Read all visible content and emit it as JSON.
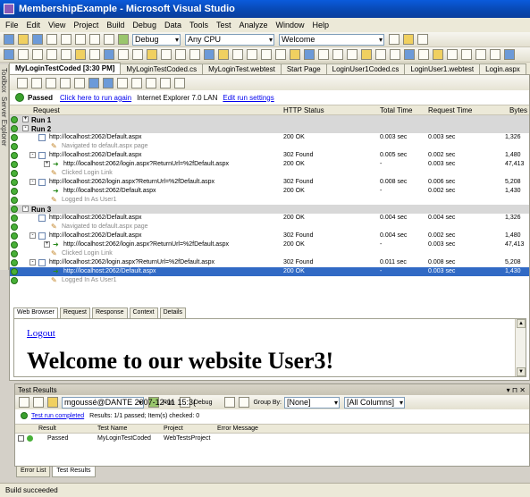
{
  "window": {
    "title": "MembershipExample - Microsoft Visual Studio"
  },
  "menu": [
    "File",
    "Edit",
    "View",
    "Project",
    "Build",
    "Debug",
    "Data",
    "Tools",
    "Test",
    "Analyze",
    "Window",
    "Help"
  ],
  "toolbar": {
    "config": "Debug",
    "platform": "Any CPU",
    "find": "Welcome"
  },
  "side_tabs": [
    "Toolbox",
    "Server Explorer"
  ],
  "doc_tabs": [
    "MyLoginTestCoded [3:30 PM]",
    "MyLoginTestCoded.cs",
    "MyLoginTest.webtest",
    "Start Page",
    "LoginUser1Coded.cs",
    "LoginUser1.webtest",
    "Login.aspx"
  ],
  "webtest": {
    "status": "Passed",
    "run_again": "Click here to run again",
    "browser_info": "Internet Explorer 7.0  LAN",
    "edit_settings": "Edit run settings",
    "columns": {
      "request": "Request",
      "http_status": "HTTP Status",
      "total_time": "Total Time",
      "request_time": "Request Time",
      "bytes": "Bytes"
    },
    "rows": [
      {
        "kind": "run",
        "label": "Run 1",
        "exp": "+",
        "status": "",
        "total": "",
        "req": "",
        "bytes": ""
      },
      {
        "kind": "run",
        "label": "Run 2",
        "exp": "-",
        "status": "",
        "total": "",
        "req": "",
        "bytes": ""
      },
      {
        "kind": "req",
        "label": "http://localhost:2062/Default.aspx",
        "status": "200 OK",
        "total": "0.003 sec",
        "req": "0.003 sec",
        "bytes": "1,326"
      },
      {
        "kind": "note",
        "label": "Navigated to default.aspx page",
        "status": "",
        "total": "",
        "req": "",
        "bytes": ""
      },
      {
        "kind": "req",
        "exp": "-",
        "label": "http://localhost:2062/Default.aspx",
        "status": "302 Found",
        "total": "0.005 sec",
        "req": "0.002 sec",
        "bytes": "1,480"
      },
      {
        "kind": "redirect",
        "exp": "+",
        "label": "http://localhost:2062/login.aspx?ReturnUrl=%2fDefault.aspx",
        "status": "200 OK",
        "total": "-",
        "req": "0.003 sec",
        "bytes": "47,413"
      },
      {
        "kind": "note",
        "label": "Clicked Login Link",
        "status": "",
        "total": "",
        "req": "",
        "bytes": ""
      },
      {
        "kind": "req",
        "exp": "-",
        "label": "http://localhost:2062/login.aspx?ReturnUrl=%2fDefault.aspx",
        "status": "302 Found",
        "total": "0.008 sec",
        "req": "0.006 sec",
        "bytes": "5,208"
      },
      {
        "kind": "redirect",
        "label": "http://localhost:2062/Default.aspx",
        "status": "200 OK",
        "total": "-",
        "req": "0.002 sec",
        "bytes": "1,430"
      },
      {
        "kind": "note",
        "label": "Logged In As User1",
        "status": "",
        "total": "",
        "req": "",
        "bytes": ""
      },
      {
        "kind": "run",
        "label": "Run 3",
        "exp": "-",
        "status": "",
        "total": "",
        "req": "",
        "bytes": ""
      },
      {
        "kind": "req",
        "label": "http://localhost:2062/Default.aspx",
        "status": "200 OK",
        "total": "0.004 sec",
        "req": "0.004 sec",
        "bytes": "1,326"
      },
      {
        "kind": "note",
        "label": "Navigated to default.aspx page",
        "status": "",
        "total": "",
        "req": "",
        "bytes": ""
      },
      {
        "kind": "req",
        "exp": "-",
        "label": "http://localhost:2062/Default.aspx",
        "status": "302 Found",
        "total": "0.004 sec",
        "req": "0.002 sec",
        "bytes": "1,480"
      },
      {
        "kind": "redirect",
        "exp": "+",
        "label": "http://localhost:2062/login.aspx?ReturnUrl=%2fDefault.aspx",
        "status": "200 OK",
        "total": "-",
        "req": "0.003 sec",
        "bytes": "47,413"
      },
      {
        "kind": "note",
        "label": "Clicked Login Link",
        "status": "",
        "total": "",
        "req": "",
        "bytes": ""
      },
      {
        "kind": "req",
        "exp": "-",
        "label": "http://localhost:2062/login.aspx?ReturnUrl=%2fDefault.aspx",
        "status": "302 Found",
        "total": "0.011 sec",
        "req": "0.008 sec",
        "bytes": "5,208"
      },
      {
        "kind": "redirect",
        "sel": true,
        "label": "http://localhost:2062/Default.aspx",
        "status": "200 OK",
        "total": "-",
        "req": "0.003 sec",
        "bytes": "1,430"
      },
      {
        "kind": "note",
        "label": "Logged In As User1",
        "status": "",
        "total": "",
        "req": "",
        "bytes": ""
      }
    ],
    "sub_tabs": [
      "Web Browser",
      "Request",
      "Response",
      "Context",
      "Details"
    ],
    "browser": {
      "logout": "Logout",
      "heading": "Welcome to our website User3!"
    }
  },
  "test_results": {
    "title": "Test Results",
    "user": "mgoussé@DANTE 2007-12-11 15:3(",
    "run": "Run",
    "debug": "Debug",
    "group_by_label": "Group By:",
    "group_by": "[None]",
    "columns_combo": "[All Columns]",
    "summary_link": "Test run completed",
    "summary_text": "Results: 1/1 passed;  Item(s) checked: 0",
    "columns": [
      "Result",
      "Test Name",
      "Project",
      "Error Message"
    ],
    "row": {
      "result": "Passed",
      "name": "MyLoginTestCoded",
      "project": "WebTestsProject",
      "error": ""
    }
  },
  "bottom_tabs": [
    "Error List",
    "Test Results"
  ],
  "status_bar": "Build succeeded"
}
